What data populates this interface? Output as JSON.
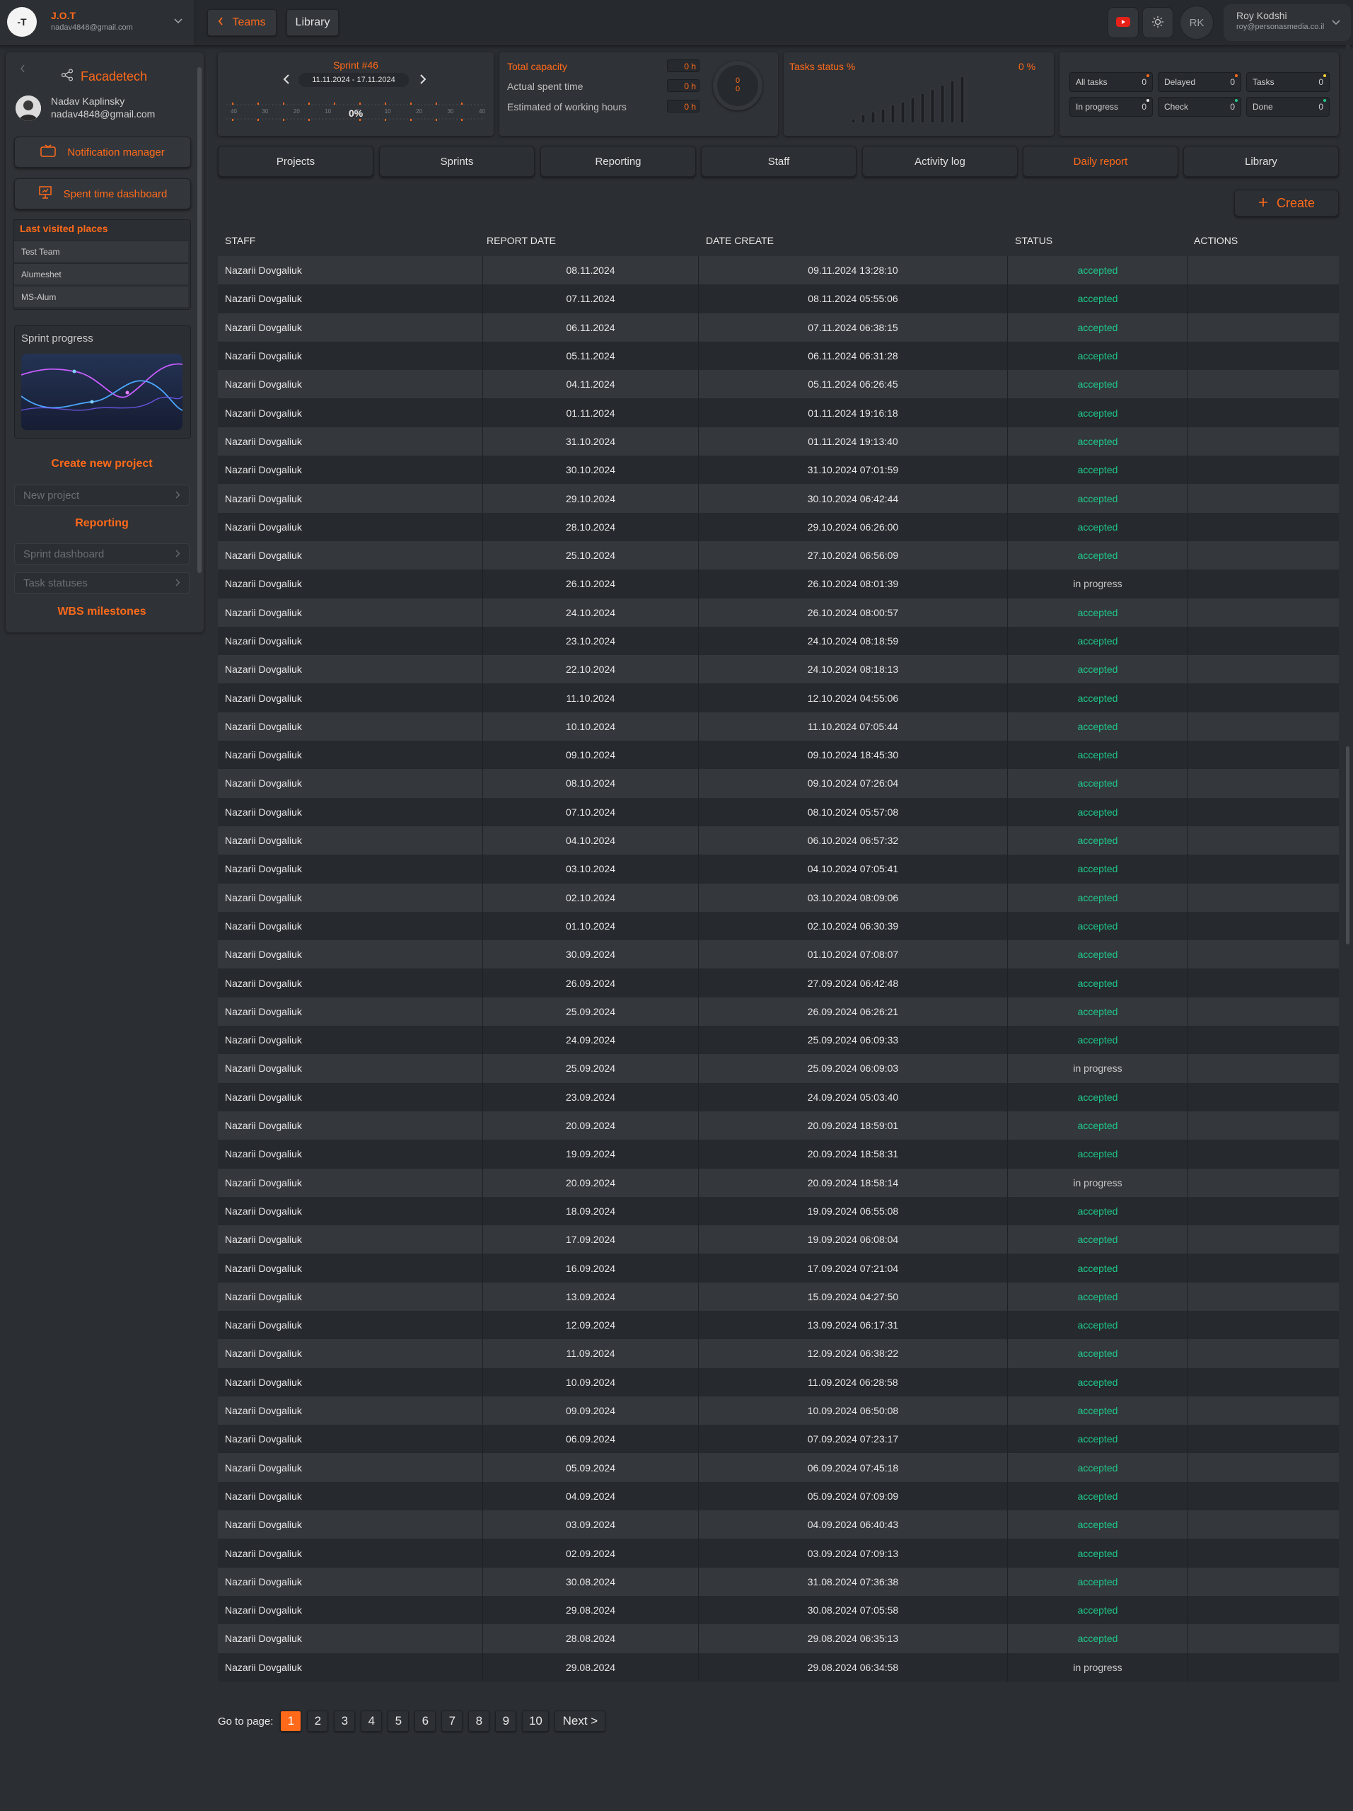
{
  "org": {
    "name": "J.O.T",
    "email": "nadav4848@gmail.com",
    "logo": "-T"
  },
  "nav": {
    "back_label": "Teams",
    "library_label": "Library"
  },
  "user": {
    "initials": "RK",
    "name": "Roy Kodshi",
    "email": "roy@personasmedia.co.il"
  },
  "sidebar": {
    "company": "Facadetech",
    "owner_name": "Nadav Kaplinsky",
    "owner_email": "nadav4848@gmail.com",
    "notification_label": "Notification manager",
    "spent_time_label": "Spent time dashboard",
    "last_visited_title": "Last visited places",
    "last_visited": [
      "Test Team",
      "Alumeshet",
      "MS-Alum"
    ],
    "sprint_progress_title": "Sprint progress",
    "create_project_label": "Create new project",
    "new_project_placeholder": "New project",
    "reporting_label": "Reporting",
    "sprint_dashboard_placeholder": "Sprint dashboard",
    "task_statuses_placeholder": "Task statuses",
    "wbs_label": "WBS milestones"
  },
  "sprint": {
    "title": "Sprint #46",
    "range": "11.11.2024 - 17.11.2024",
    "percent": "0%",
    "scale": [
      "40",
      "30",
      "20",
      "10",
      "0",
      "10",
      "20",
      "30",
      "40"
    ]
  },
  "capacity": {
    "title": "Total capacity",
    "total": "0 h",
    "actual_label": "Actual spent time",
    "actual": "0 h",
    "estimated_label": "Estimated of working hours",
    "estimated": "0 h",
    "ring_top": "0",
    "ring_bottom": "0"
  },
  "tasks_status": {
    "title": "Tasks status %",
    "percent": "0 %"
  },
  "counters": [
    {
      "label": "All tasks",
      "value": "0",
      "dot": "#ff6a1a"
    },
    {
      "label": "Delayed",
      "value": "0",
      "dot": "#ff6a1a"
    },
    {
      "label": "Tasks",
      "value": "0",
      "dot": "#f5d33a"
    },
    {
      "label": "In progress",
      "value": "0",
      "dot": "#e8e8e8"
    },
    {
      "label": "Check",
      "value": "0",
      "dot": "#1fc98a"
    },
    {
      "label": "Done",
      "value": "0",
      "dot": "#1fc98a"
    }
  ],
  "tabs": [
    "Projects",
    "Sprints",
    "Reporting",
    "Staff",
    "Activity log",
    "Daily report",
    "Library"
  ],
  "active_tab": "Daily report",
  "create_label": "Create",
  "table": {
    "headers": [
      "STAFF",
      "REPORT DATE",
      "DATE CREATE",
      "STATUS",
      "ACTIONS"
    ],
    "rows": [
      [
        "Nazarii Dovgaliuk",
        "08.11.2024",
        "09.11.2024 13:28:10",
        "accepted"
      ],
      [
        "Nazarii Dovgaliuk",
        "07.11.2024",
        "08.11.2024 05:55:06",
        "accepted"
      ],
      [
        "Nazarii Dovgaliuk",
        "06.11.2024",
        "07.11.2024 06:38:15",
        "accepted"
      ],
      [
        "Nazarii Dovgaliuk",
        "05.11.2024",
        "06.11.2024 06:31:28",
        "accepted"
      ],
      [
        "Nazarii Dovgaliuk",
        "04.11.2024",
        "05.11.2024 06:26:45",
        "accepted"
      ],
      [
        "Nazarii Dovgaliuk",
        "01.11.2024",
        "01.11.2024 19:16:18",
        "accepted"
      ],
      [
        "Nazarii Dovgaliuk",
        "31.10.2024",
        "01.11.2024 19:13:40",
        "accepted"
      ],
      [
        "Nazarii Dovgaliuk",
        "30.10.2024",
        "31.10.2024 07:01:59",
        "accepted"
      ],
      [
        "Nazarii Dovgaliuk",
        "29.10.2024",
        "30.10.2024 06:42:44",
        "accepted"
      ],
      [
        "Nazarii Dovgaliuk",
        "28.10.2024",
        "29.10.2024 06:26:00",
        "accepted"
      ],
      [
        "Nazarii Dovgaliuk",
        "25.10.2024",
        "27.10.2024 06:56:09",
        "accepted"
      ],
      [
        "Nazarii Dovgaliuk",
        "26.10.2024",
        "26.10.2024 08:01:39",
        "in progress"
      ],
      [
        "Nazarii Dovgaliuk",
        "24.10.2024",
        "26.10.2024 08:00:57",
        "accepted"
      ],
      [
        "Nazarii Dovgaliuk",
        "23.10.2024",
        "24.10.2024 08:18:59",
        "accepted"
      ],
      [
        "Nazarii Dovgaliuk",
        "22.10.2024",
        "24.10.2024 08:18:13",
        "accepted"
      ],
      [
        "Nazarii Dovgaliuk",
        "11.10.2024",
        "12.10.2024 04:55:06",
        "accepted"
      ],
      [
        "Nazarii Dovgaliuk",
        "10.10.2024",
        "11.10.2024 07:05:44",
        "accepted"
      ],
      [
        "Nazarii Dovgaliuk",
        "09.10.2024",
        "09.10.2024 18:45:30",
        "accepted"
      ],
      [
        "Nazarii Dovgaliuk",
        "08.10.2024",
        "09.10.2024 07:26:04",
        "accepted"
      ],
      [
        "Nazarii Dovgaliuk",
        "07.10.2024",
        "08.10.2024 05:57:08",
        "accepted"
      ],
      [
        "Nazarii Dovgaliuk",
        "04.10.2024",
        "06.10.2024 06:57:32",
        "accepted"
      ],
      [
        "Nazarii Dovgaliuk",
        "03.10.2024",
        "04.10.2024 07:05:41",
        "accepted"
      ],
      [
        "Nazarii Dovgaliuk",
        "02.10.2024",
        "03.10.2024 08:09:06",
        "accepted"
      ],
      [
        "Nazarii Dovgaliuk",
        "01.10.2024",
        "02.10.2024 06:30:39",
        "accepted"
      ],
      [
        "Nazarii Dovgaliuk",
        "30.09.2024",
        "01.10.2024 07:08:07",
        "accepted"
      ],
      [
        "Nazarii Dovgaliuk",
        "26.09.2024",
        "27.09.2024 06:42:48",
        "accepted"
      ],
      [
        "Nazarii Dovgaliuk",
        "25.09.2024",
        "26.09.2024 06:26:21",
        "accepted"
      ],
      [
        "Nazarii Dovgaliuk",
        "24.09.2024",
        "25.09.2024 06:09:33",
        "accepted"
      ],
      [
        "Nazarii Dovgaliuk",
        "25.09.2024",
        "25.09.2024 06:09:03",
        "in progress"
      ],
      [
        "Nazarii Dovgaliuk",
        "23.09.2024",
        "24.09.2024 05:03:40",
        "accepted"
      ],
      [
        "Nazarii Dovgaliuk",
        "20.09.2024",
        "20.09.2024 18:59:01",
        "accepted"
      ],
      [
        "Nazarii Dovgaliuk",
        "19.09.2024",
        "20.09.2024 18:58:31",
        "accepted"
      ],
      [
        "Nazarii Dovgaliuk",
        "20.09.2024",
        "20.09.2024 18:58:14",
        "in progress"
      ],
      [
        "Nazarii Dovgaliuk",
        "18.09.2024",
        "19.09.2024 06:55:08",
        "accepted"
      ],
      [
        "Nazarii Dovgaliuk",
        "17.09.2024",
        "19.09.2024 06:08:04",
        "accepted"
      ],
      [
        "Nazarii Dovgaliuk",
        "16.09.2024",
        "17.09.2024 07:21:04",
        "accepted"
      ],
      [
        "Nazarii Dovgaliuk",
        "13.09.2024",
        "15.09.2024 04:27:50",
        "accepted"
      ],
      [
        "Nazarii Dovgaliuk",
        "12.09.2024",
        "13.09.2024 06:17:31",
        "accepted"
      ],
      [
        "Nazarii Dovgaliuk",
        "11.09.2024",
        "12.09.2024 06:38:22",
        "accepted"
      ],
      [
        "Nazarii Dovgaliuk",
        "10.09.2024",
        "11.09.2024 06:28:58",
        "accepted"
      ],
      [
        "Nazarii Dovgaliuk",
        "09.09.2024",
        "10.09.2024 06:50:08",
        "accepted"
      ],
      [
        "Nazarii Dovgaliuk",
        "06.09.2024",
        "07.09.2024 07:23:17",
        "accepted"
      ],
      [
        "Nazarii Dovgaliuk",
        "05.09.2024",
        "06.09.2024 07:45:18",
        "accepted"
      ],
      [
        "Nazarii Dovgaliuk",
        "04.09.2024",
        "05.09.2024 07:09:09",
        "accepted"
      ],
      [
        "Nazarii Dovgaliuk",
        "03.09.2024",
        "04.09.2024 06:40:43",
        "accepted"
      ],
      [
        "Nazarii Dovgaliuk",
        "02.09.2024",
        "03.09.2024 07:09:13",
        "accepted"
      ],
      [
        "Nazarii Dovgaliuk",
        "30.08.2024",
        "31.08.2024 07:36:38",
        "accepted"
      ],
      [
        "Nazarii Dovgaliuk",
        "29.08.2024",
        "30.08.2024 07:05:58",
        "accepted"
      ],
      [
        "Nazarii Dovgaliuk",
        "28.08.2024",
        "29.08.2024 06:35:13",
        "accepted"
      ],
      [
        "Nazarii Dovgaliuk",
        "29.08.2024",
        "29.08.2024 06:34:58",
        "in progress"
      ]
    ]
  },
  "pagination": {
    "label": "Go to page:",
    "pages": [
      "1",
      "2",
      "3",
      "4",
      "5",
      "6",
      "7",
      "8",
      "9",
      "10"
    ],
    "current": "1",
    "next_label": "Next >"
  },
  "colors": {
    "accent": "#ff6a1a",
    "accepted": "#1fc98a",
    "background": "#2b2e33"
  }
}
